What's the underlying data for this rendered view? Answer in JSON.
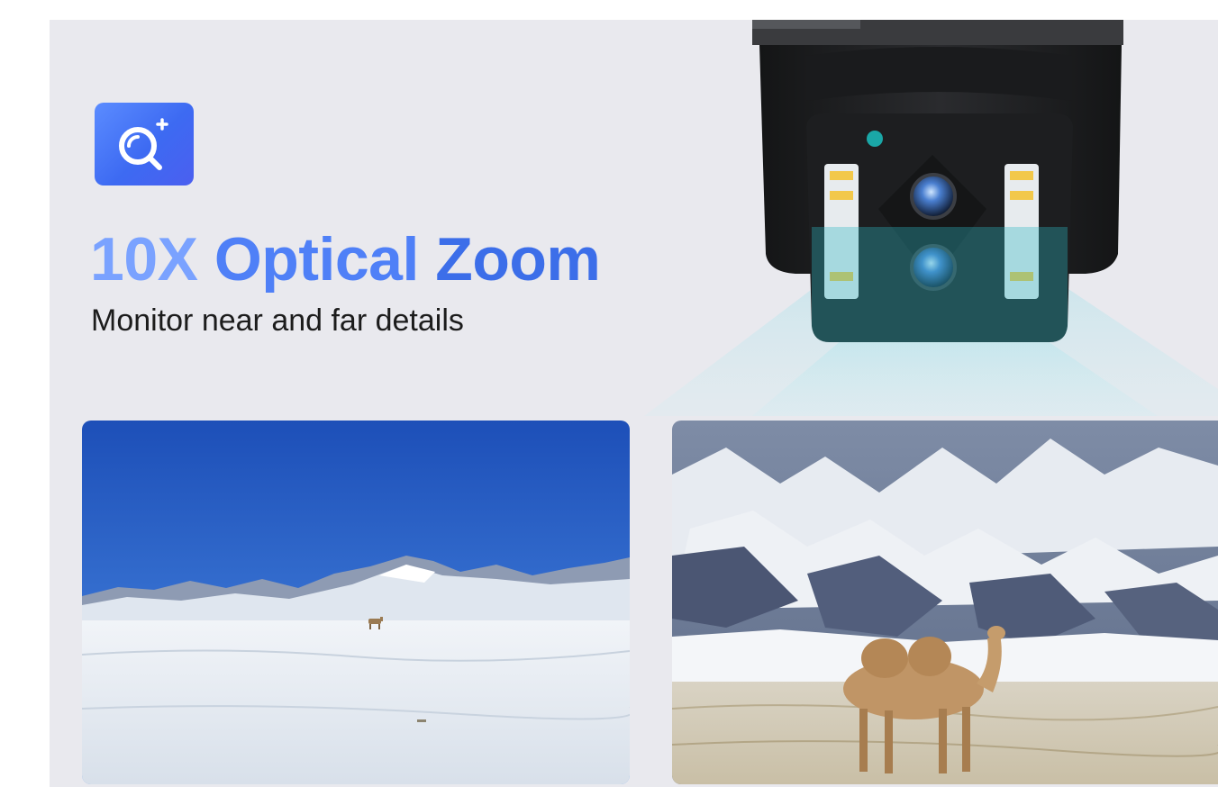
{
  "headline": {
    "part_a": "10X ",
    "part_b": "Optical ",
    "part_c": "Zoom"
  },
  "subheadline": "Monitor near and far details",
  "icons": {
    "badge": "zoom-in-icon",
    "product": "ptz-camera-icon"
  },
  "photos": {
    "wide": "snowy-plain-with-distant-camel",
    "zoom": "zoomed-camel-in-front-of-snowy-mountains"
  },
  "colors": {
    "background": "#e9e9ee",
    "badge": "#4f7cf5",
    "headline_light": "#7aa2ff",
    "headline_dark": "#3c6ee9",
    "beam": "#8fe3ee",
    "camera_body": "#1f2022"
  }
}
